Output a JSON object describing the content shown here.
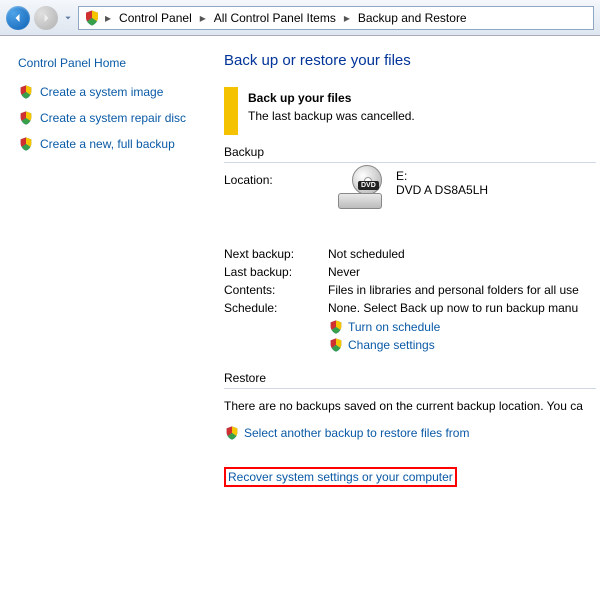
{
  "breadcrumb": {
    "a": "Control Panel",
    "b": "All Control Panel Items",
    "c": "Backup and Restore"
  },
  "sidebar": {
    "home": "Control Panel Home",
    "items": [
      {
        "label": "Create a system image"
      },
      {
        "label": "Create a system repair disc"
      },
      {
        "label": "Create a new, full backup"
      }
    ]
  },
  "main": {
    "title": "Back up or restore your files",
    "alert_head": "Back up your files",
    "alert_msg": "The last backup was cancelled.",
    "section_backup": "Backup",
    "loc_label": "Location:",
    "loc_line1": "E:",
    "loc_line2": "DVD A  DS8A5LH",
    "next_label": "Next backup:",
    "next_val": "Not scheduled",
    "last_label": "Last backup:",
    "last_val": "Never",
    "contents_label": "Contents:",
    "contents_val": "Files in libraries and personal folders for all use",
    "sched_label": "Schedule:",
    "sched_val": "None. Select Back up now to run backup manu",
    "turn_on": "Turn on schedule",
    "change": "Change settings",
    "section_restore": "Restore",
    "restore_msg": "There are no backups saved on the current backup location. You ca",
    "select_another": "Select another backup to restore files from",
    "recover": "Recover system settings or your computer"
  }
}
